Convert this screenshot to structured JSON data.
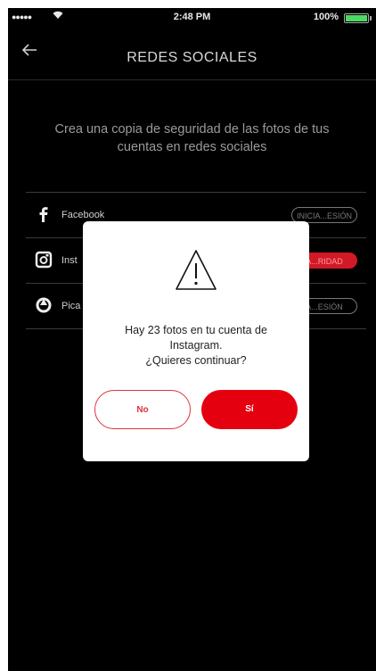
{
  "status_bar": {
    "signal": "●●●●●",
    "time": "2:48 PM",
    "battery": "100%"
  },
  "nav": {
    "title": "REDES SOCIALES",
    "back_icon": "arrow-left-icon"
  },
  "intro": "Crea una copia de seguridad de las fotos de tus cuentas en redes sociales",
  "accounts": [
    {
      "label": "Facebook",
      "action": "INICIA...ESIÓN",
      "icon": "facebook-icon",
      "active": false
    },
    {
      "label": "Inst",
      "action": "A...RIDAD",
      "icon": "instagram-icon",
      "active": true
    },
    {
      "label": "Pica",
      "action": "A...ESIÓN",
      "icon": "picasa-icon",
      "active": false
    }
  ],
  "dialog": {
    "icon": "warning-icon",
    "line1": "Hay 23 fotos en tu cuenta de",
    "line2": "Instagram.",
    "line3": "¿Quieres continuar?",
    "no": "No",
    "yes": "Sí"
  },
  "colors": {
    "background": "#000000",
    "accent": "#e5000f",
    "battery": "#4cd964"
  }
}
